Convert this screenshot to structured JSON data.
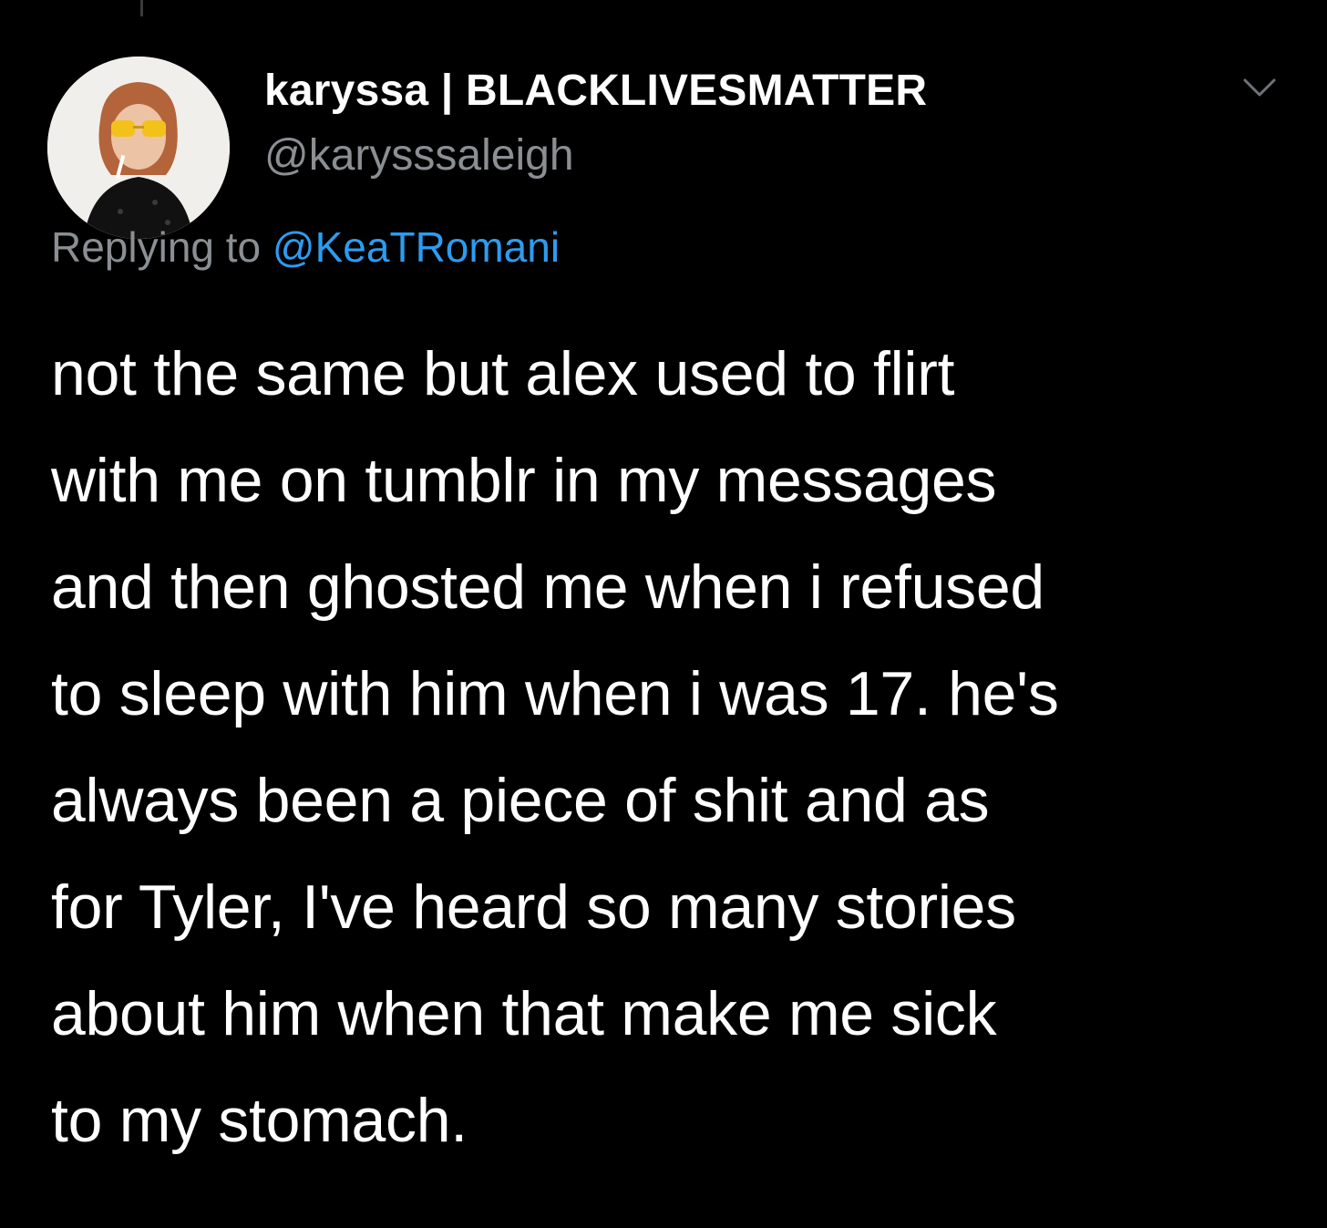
{
  "tweet": {
    "author": {
      "display_name": "karyssa | BLACKLIVESMATTER",
      "handle": "@karysssaleigh",
      "avatar_icon": "profile-photo"
    },
    "menu_icon": "chevron-down-icon",
    "reply_context": {
      "prefix": "Replying to",
      "mention": "@KeaTRomani"
    },
    "text": "not the same but alex used to flirt\nwith me on tumblr in my messages\nand then ghosted me when i refused\nto sleep with him when i was 17. he's\nalways been a piece of shit and as\nfor Tyler, I've heard so many stories\nabout him when that make me sick\nto my stomach.",
    "colors": {
      "background": "#000000",
      "primary_text": "#ffffff",
      "secondary_text": "#8b8f93",
      "link": "#2d9cf0"
    }
  }
}
